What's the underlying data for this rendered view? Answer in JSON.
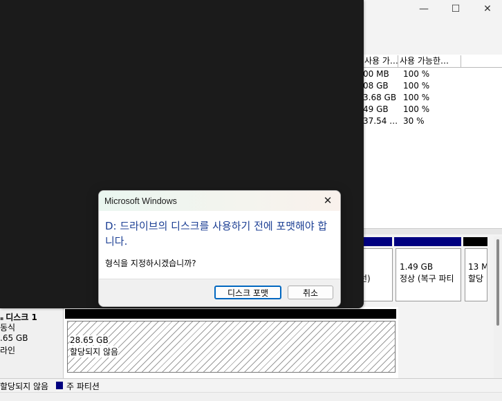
{
  "window": {
    "controls": {
      "minimize": "—",
      "maximize": "☐",
      "close": "✕"
    }
  },
  "volume_table": {
    "headers": [
      "사용 가…",
      "사용 가능한…"
    ],
    "rows": [
      {
        "free": "00 MB",
        "pct": "100 %"
      },
      {
        "free": "08 GB",
        "pct": "100 %"
      },
      {
        "free": "3.68 GB",
        "pct": "100 %"
      },
      {
        "free": "49 GB",
        "pct": "100 %"
      },
      {
        "free": "37.54 …",
        "pct": "30 %"
      }
    ]
  },
  "disk0": {
    "partial_text": "선)",
    "recovery": {
      "size": "1.49 GB",
      "status": "정상 (복구 파티"
    },
    "last": {
      "size": "13 M",
      "status": "할당"
    }
  },
  "disk1": {
    "name": "디스크 1",
    "type": "동식",
    "size": ".65 GB",
    "state": "라인",
    "unallocated": {
      "size": "28.65 GB",
      "label": "할당되지 않음"
    }
  },
  "legend": {
    "unallocated": "할당되지 않음",
    "primary": "주 파티션",
    "primary_color": "#000080"
  },
  "dialog": {
    "title": "Microsoft Windows",
    "close_glyph": "✕",
    "main_text": "D: 드라이브의 디스크를 사용하기 전에 포맷해야 합니다.",
    "sub_text": "형식을 지정하시겠습니까?",
    "format_button": "디스크 포맷",
    "cancel_button": "취소"
  }
}
